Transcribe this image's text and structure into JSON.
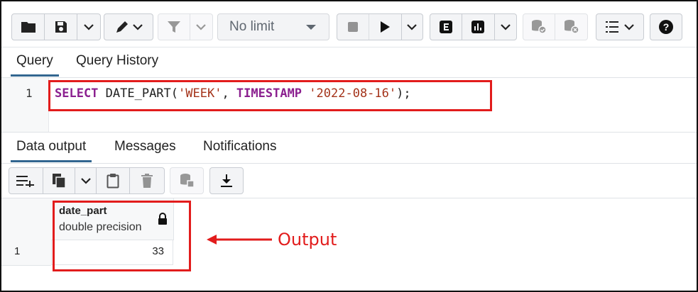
{
  "toolbar": {
    "row_limit": "No limit",
    "icons": [
      "folder-icon",
      "save-icon",
      "chevron-down-icon",
      "edit-pen-icon",
      "chevron-down-icon",
      "filter-icon",
      "chevron-down-icon",
      "stop-icon",
      "play-icon",
      "chevron-down-icon",
      "explain-icon",
      "explain-analyze-icon",
      "chevron-down-icon",
      "commit-icon",
      "rollback-icon",
      "macros-icon",
      "help-icon"
    ]
  },
  "query_tabs": [
    "Query",
    "Query History"
  ],
  "editor": {
    "line_number": "1",
    "tokens": {
      "kw1": "SELECT",
      "fn": " DATE_PART(",
      "str1": "'WEEK'",
      "sep": ", ",
      "kw2": "TIMESTAMP",
      "sp": " ",
      "str2": "'2022-08-16'",
      "end": ");"
    }
  },
  "output_tabs": [
    "Data output",
    "Messages",
    "Notifications"
  ],
  "output_toolbar_icons": [
    "add-row-icon",
    "copy-icon",
    "chevron-down-icon",
    "paste-icon",
    "delete-icon",
    "save-data-icon",
    "download-icon"
  ],
  "result": {
    "column_name": "date_part",
    "column_type": "double precision",
    "row_number": "1",
    "value": "33"
  },
  "annotation": {
    "label": "Output"
  },
  "colors": {
    "accent": "#326690",
    "highlight": "#e21c1c",
    "keyword": "#8b1f8f",
    "string": "#a4331a"
  }
}
